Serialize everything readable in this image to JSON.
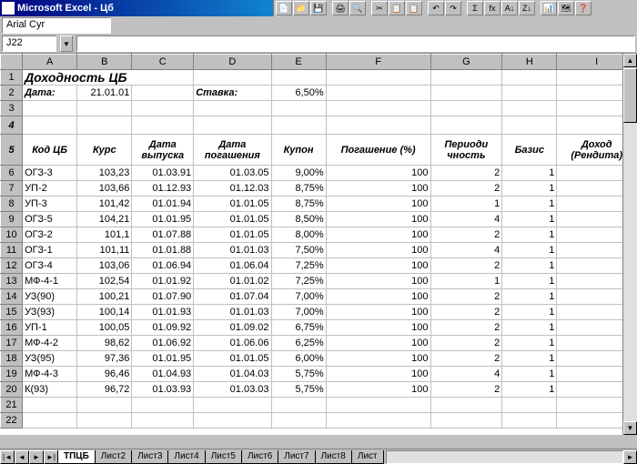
{
  "app": {
    "title": "Microsoft Excel - Цб",
    "font_name": "Arial Cyr",
    "cell_ref": "J22"
  },
  "columns": [
    "A",
    "B",
    "C",
    "D",
    "E",
    "F",
    "G",
    "H",
    "I"
  ],
  "row_numbers": [
    1,
    2,
    3,
    4,
    5,
    6,
    7,
    8,
    9,
    10,
    11,
    12,
    13,
    14,
    15,
    16,
    17,
    18,
    19,
    20,
    21,
    22
  ],
  "content": {
    "title": "Доходность ЦБ",
    "date_label": "Дата:",
    "date_value": "21.01.01",
    "rate_label": "Ставка:",
    "rate_value": "6,50%",
    "headers": {
      "A": "Код ЦБ",
      "B": "Курс",
      "C": "Дата выпуска",
      "D": "Дата погашения",
      "E": "Купон",
      "F": "Погашение (%)",
      "G": "Периоди чность",
      "H": "Базис",
      "I": "Доход (Рендита)"
    },
    "rows": [
      {
        "code": "ОГЗ-3",
        "price": "103,23",
        "issue": "01.03.91",
        "maturity": "01.03.05",
        "coupon": "9,00%",
        "redemption": "100",
        "freq": "2",
        "basis": "1"
      },
      {
        "code": "УП-2",
        "price": "103,66",
        "issue": "01.12.93",
        "maturity": "01.12.03",
        "coupon": "8,75%",
        "redemption": "100",
        "freq": "2",
        "basis": "1"
      },
      {
        "code": "УП-3",
        "price": "101,42",
        "issue": "01.01.94",
        "maturity": "01.01.05",
        "coupon": "8,75%",
        "redemption": "100",
        "freq": "1",
        "basis": "1"
      },
      {
        "code": "ОГЗ-5",
        "price": "104,21",
        "issue": "01.01.95",
        "maturity": "01.01.05",
        "coupon": "8,50%",
        "redemption": "100",
        "freq": "4",
        "basis": "1"
      },
      {
        "code": "ОГЗ-2",
        "price": "101,1",
        "issue": "01.07.88",
        "maturity": "01.01.05",
        "coupon": "8,00%",
        "redemption": "100",
        "freq": "2",
        "basis": "1"
      },
      {
        "code": "ОГЗ-1",
        "price": "101,11",
        "issue": "01.01.88",
        "maturity": "01.01.03",
        "coupon": "7,50%",
        "redemption": "100",
        "freq": "4",
        "basis": "1"
      },
      {
        "code": "ОГЗ-4",
        "price": "103,06",
        "issue": "01.06.94",
        "maturity": "01.06.04",
        "coupon": "7,25%",
        "redemption": "100",
        "freq": "2",
        "basis": "1"
      },
      {
        "code": "МФ-4-1",
        "price": "102,54",
        "issue": "01.01.92",
        "maturity": "01.01.02",
        "coupon": "7,25%",
        "redemption": "100",
        "freq": "1",
        "basis": "1"
      },
      {
        "code": "УЗ(90)",
        "price": "100,21",
        "issue": "01.07.90",
        "maturity": "01.07.04",
        "coupon": "7,00%",
        "redemption": "100",
        "freq": "2",
        "basis": "1"
      },
      {
        "code": "УЗ(93)",
        "price": "100,14",
        "issue": "01.01.93",
        "maturity": "01.01.03",
        "coupon": "7,00%",
        "redemption": "100",
        "freq": "2",
        "basis": "1"
      },
      {
        "code": "УП-1",
        "price": "100,05",
        "issue": "01.09.92",
        "maturity": "01.09.02",
        "coupon": "6,75%",
        "redemption": "100",
        "freq": "2",
        "basis": "1"
      },
      {
        "code": "МФ-4-2",
        "price": "98,62",
        "issue": "01.06.92",
        "maturity": "01.06.06",
        "coupon": "6,25%",
        "redemption": "100",
        "freq": "2",
        "basis": "1"
      },
      {
        "code": "УЗ(95)",
        "price": "97,36",
        "issue": "01.01.95",
        "maturity": "01.01.05",
        "coupon": "6,00%",
        "redemption": "100",
        "freq": "2",
        "basis": "1"
      },
      {
        "code": "МФ-4-3",
        "price": "96,46",
        "issue": "01.04.93",
        "maturity": "01.04.03",
        "coupon": "5,75%",
        "redemption": "100",
        "freq": "4",
        "basis": "1"
      },
      {
        "code": "К(93)",
        "price": "96,72",
        "issue": "01.03.93",
        "maturity": "01.03.03",
        "coupon": "5,75%",
        "redemption": "100",
        "freq": "2",
        "basis": "1"
      }
    ]
  },
  "tabs": {
    "active": "ТПЦБ",
    "others": [
      "Лист2",
      "Лист3",
      "Лист4",
      "Лист5",
      "Лист6",
      "Лист7",
      "Лист8",
      "Лист"
    ]
  },
  "icons": {
    "tri_down": "▼",
    "tri_left": "◄",
    "tri_right": "►",
    "bar_left": "|◄",
    "bar_right": "►|",
    "tri_up": "▲"
  }
}
